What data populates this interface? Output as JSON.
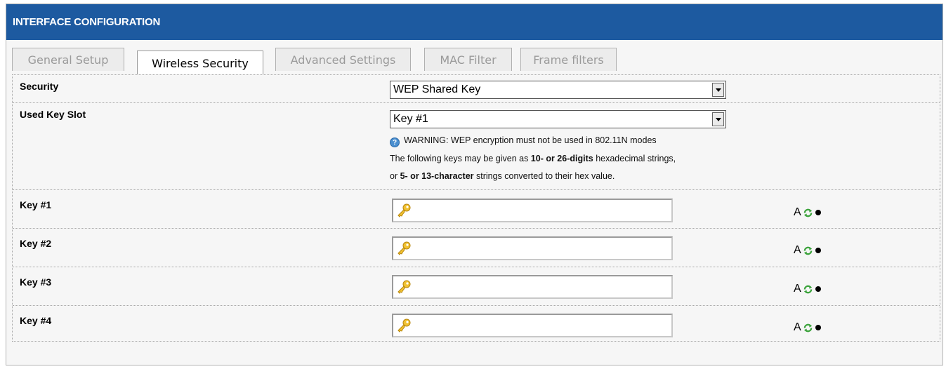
{
  "header": {
    "title": "INTERFACE CONFIGURATION"
  },
  "tabs": [
    {
      "label": "General Setup",
      "active": false
    },
    {
      "label": "Wireless Security",
      "active": true
    },
    {
      "label": "Advanced Settings",
      "active": false
    },
    {
      "label": "MAC Filter",
      "active": false
    },
    {
      "label": "Frame filters",
      "active": false
    }
  ],
  "security": {
    "label": "Security",
    "value": "WEP Shared Key"
  },
  "key_slot": {
    "label": "Used Key Slot",
    "value": "Key #1",
    "warning": "WARNING: WEP encryption must not be used in 802.11N modes",
    "hint1_a": "The following keys may be given as ",
    "hint1_b": "10- or 26-digits",
    "hint1_c": " hexadecimal strings,",
    "hint2_a": "or ",
    "hint2_b": "5- or 13-character",
    "hint2_c": " strings converted to their hex value."
  },
  "keys": [
    {
      "label": "Key #1",
      "value": ""
    },
    {
      "label": "Key #2",
      "value": ""
    },
    {
      "label": "Key #3",
      "value": ""
    },
    {
      "label": "Key #4",
      "value": ""
    }
  ],
  "tools": {
    "text_toggle": "A",
    "refresh_icon": "refresh-icon",
    "reveal_icon": "dot-icon"
  },
  "colors": {
    "header_bg": "#1d5aa0",
    "key_icon": "#e6b630",
    "refresh": "#3aa23a"
  }
}
